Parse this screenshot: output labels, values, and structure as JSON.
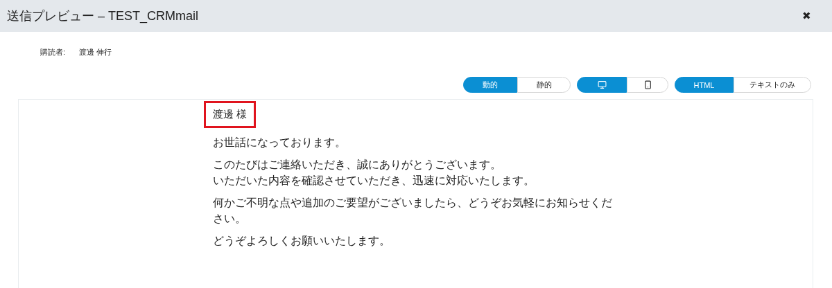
{
  "window": {
    "title": "送信プレビュー – TEST_CRMmail",
    "close": "✖"
  },
  "subscriber": {
    "label": "購読者:",
    "value": "渡邊 伸行"
  },
  "toggle_groups": [
    {
      "options": [
        {
          "kind": "text",
          "label": "動的",
          "selected": true
        },
        {
          "kind": "text",
          "label": "静的",
          "selected": false
        }
      ]
    },
    {
      "options": [
        {
          "kind": "desktop",
          "selected": true
        },
        {
          "kind": "mobile",
          "selected": false
        }
      ]
    },
    {
      "options": [
        {
          "kind": "text",
          "label": "HTML",
          "selected": true
        },
        {
          "kind": "text",
          "label": "テキストのみ",
          "selected": false
        }
      ]
    }
  ],
  "preview": {
    "greeting": {
      "text": "渡邊 様",
      "highlighted": true
    },
    "paragraphs": [
      {
        "lines": [
          "お世話になっております。"
        ]
      },
      {
        "lines": [
          "このたびはご連絡いただき、誠にありがとうございます。",
          "いただいた内容を確認させていただき、迅速に対応いたします。"
        ]
      },
      {
        "lines": [
          "何かご不明な点や追加のご要望がございましたら、どうぞお気軽にお知らせください。"
        ]
      },
      {
        "lines": [
          "どうぞよろしくお願いいたします。"
        ]
      }
    ]
  }
}
